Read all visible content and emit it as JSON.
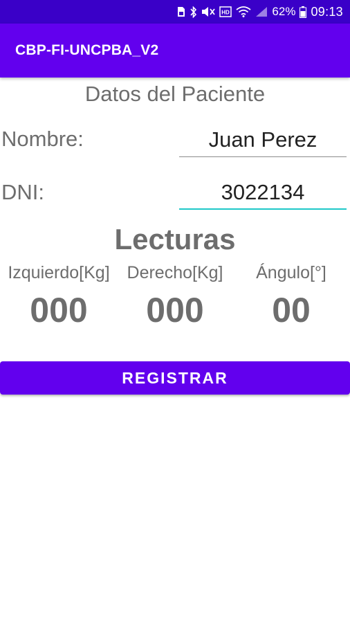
{
  "status_bar": {
    "battery_percent": "62%",
    "time": "09:13",
    "icons": [
      "sim-card-icon",
      "bluetooth-icon",
      "mute-icon",
      "hd-voice-icon",
      "wifi-icon",
      "signal-icon",
      "battery-icon"
    ]
  },
  "app_bar": {
    "title": "CBP-FI-UNCPBA_V2"
  },
  "patient": {
    "section_title": "Datos del Paciente",
    "name_label": "Nombre:",
    "name_value": "Juan Perez",
    "dni_label": "DNI:",
    "dni_value": "3022134"
  },
  "readings": {
    "title": "Lecturas",
    "columns": [
      {
        "label": "Izquierdo[Kg]",
        "value": "000"
      },
      {
        "label": "Derecho[Kg]",
        "value": "000"
      },
      {
        "label": "Ángulo[°]",
        "value": "00"
      }
    ]
  },
  "actions": {
    "register_label": "REGISTRAR"
  },
  "colors": {
    "status_bar": "#3a00c8",
    "primary": "#6200ee",
    "focused_underline": "#1ec8c8",
    "text_gray": "#6d6d6d"
  }
}
